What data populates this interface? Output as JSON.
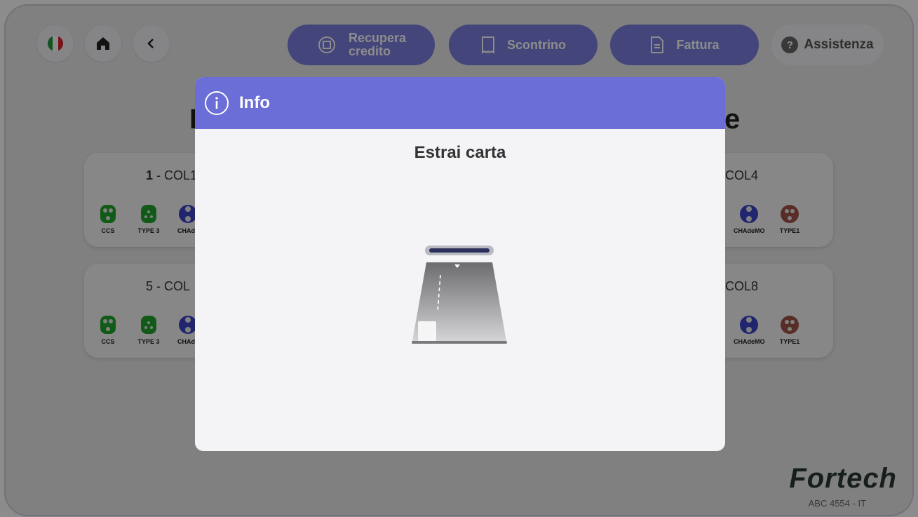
{
  "topbar": {
    "language": "Italiano",
    "home_icon": "home-icon",
    "back_icon": "chevron-left-icon",
    "recover_credit": {
      "line1": "Recupera",
      "line2": "credito",
      "icon": "refund-icon"
    },
    "receipt": {
      "label": "Scontrino",
      "icon": "receipt-icon"
    },
    "invoice": {
      "label": "Fattura",
      "icon": "document-icon"
    },
    "help": {
      "label": "Assistenza",
      "symbol": "?"
    }
  },
  "page": {
    "heading_left": "I",
    "heading_right": "e"
  },
  "columns": [
    {
      "number": "1",
      "name": "- COL1",
      "connectors": [
        "CCS",
        "TYPE 3",
        "CHAde"
      ]
    },
    {
      "number": "",
      "name": "COL4",
      "connectors": [
        "CHAdeMO",
        "TYPE1"
      ]
    },
    {
      "number": "5",
      "name": "- COL",
      "connectors": [
        "CCS",
        "TYPE 3",
        "CHAde"
      ]
    },
    {
      "number": "",
      "name": "COL8",
      "connectors": [
        "CHAdeMO",
        "TYPE1"
      ]
    }
  ],
  "colors": {
    "accent": "#6a6ed6",
    "ccs": "#1fa52a",
    "chademo": "#3b44c9",
    "type1": "#a0524a"
  },
  "brand": {
    "name": "Fortech",
    "code": "ABC 4554 - IT"
  },
  "modal": {
    "title": "Info",
    "message": "Estrai carta",
    "icon": "info-icon"
  }
}
